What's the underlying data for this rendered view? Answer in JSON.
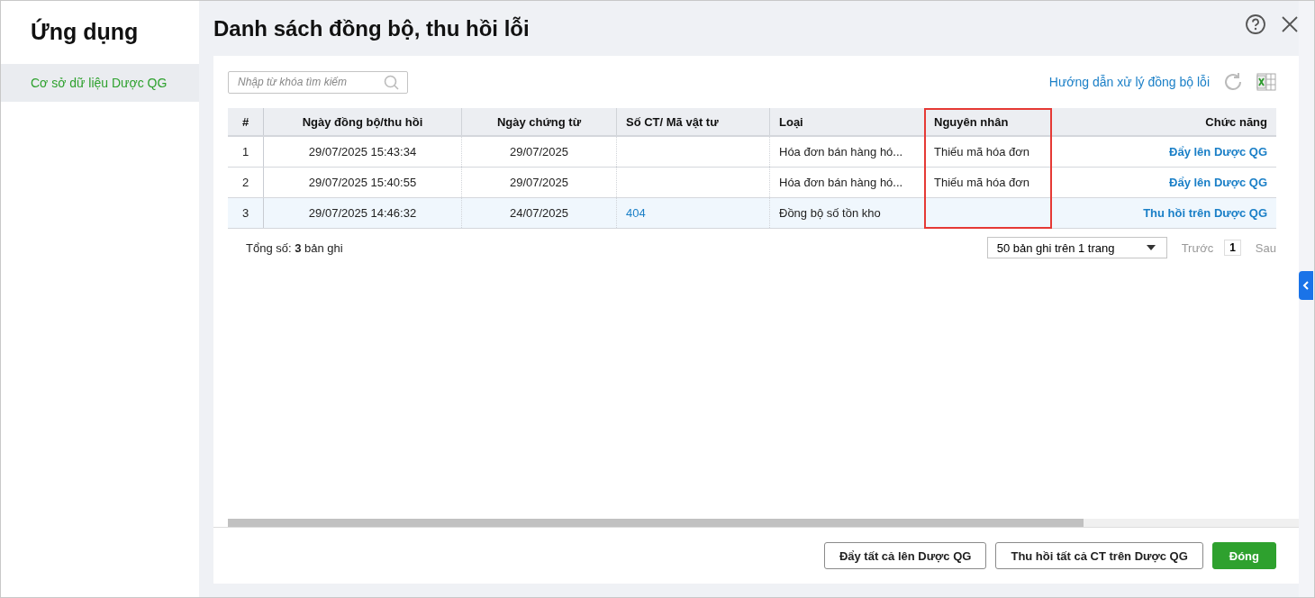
{
  "sidebar": {
    "title": "Ứng dụng",
    "items": [
      {
        "label": "Cơ sở dữ liệu Dược QG",
        "selected": true
      }
    ]
  },
  "dialog": {
    "title": "Danh sách đồng bộ, thu hồi lỗi"
  },
  "search": {
    "placeholder": "Nhập từ khóa tìm kiếm"
  },
  "help_link": "Hướng dẫn xử lý đồng bộ lỗi",
  "table": {
    "columns": [
      {
        "label": "#",
        "highlighted": false
      },
      {
        "label": "Ngày đồng bộ/thu hồi",
        "highlighted": false
      },
      {
        "label": "Ngày chứng từ",
        "highlighted": false
      },
      {
        "label": "Số CT/ Mã vật tư",
        "highlighted": false
      },
      {
        "label": "Loại",
        "highlighted": false
      },
      {
        "label": "Nguyên nhân",
        "highlighted": true
      },
      {
        "label": "Chức năng",
        "highlighted": false
      }
    ],
    "rows": [
      {
        "selected": false,
        "cells": [
          "1",
          "29/07/2025 15:43:34",
          "29/07/2025",
          null,
          "Hóa đơn bán hàng hó...",
          "Thiếu mã hóa đơn",
          "Đẩy lên Dược QG"
        ]
      },
      {
        "selected": false,
        "cells": [
          "2",
          "29/07/2025 15:40:55",
          "29/07/2025",
          null,
          "Hóa đơn bán hàng hó...",
          "Thiếu mã hóa đơn",
          "Đẩy lên Dược QG"
        ]
      },
      {
        "selected": true,
        "cells": [
          "3",
          "29/07/2025 14:46:32",
          "24/07/2025",
          "404",
          "Đồng bộ số tồn kho",
          null,
          "Thu hồi trên Dược QG"
        ]
      }
    ]
  },
  "pager": {
    "total": "Tổng số: **3** bản ghi",
    "page_size": "50 bản ghi trên 1 trang",
    "prev": "Trước",
    "page": "1",
    "next": "Sau",
    "prev_disabled": true
  },
  "buttons": [
    {
      "label": "Đẩy tất cả lên Dược QG",
      "kind": "secondary"
    },
    {
      "label": "Thu hồi tất cả CT trên Dược QG",
      "kind": "secondary"
    },
    {
      "label": "Đóng",
      "kind": "primary"
    }
  ]
}
